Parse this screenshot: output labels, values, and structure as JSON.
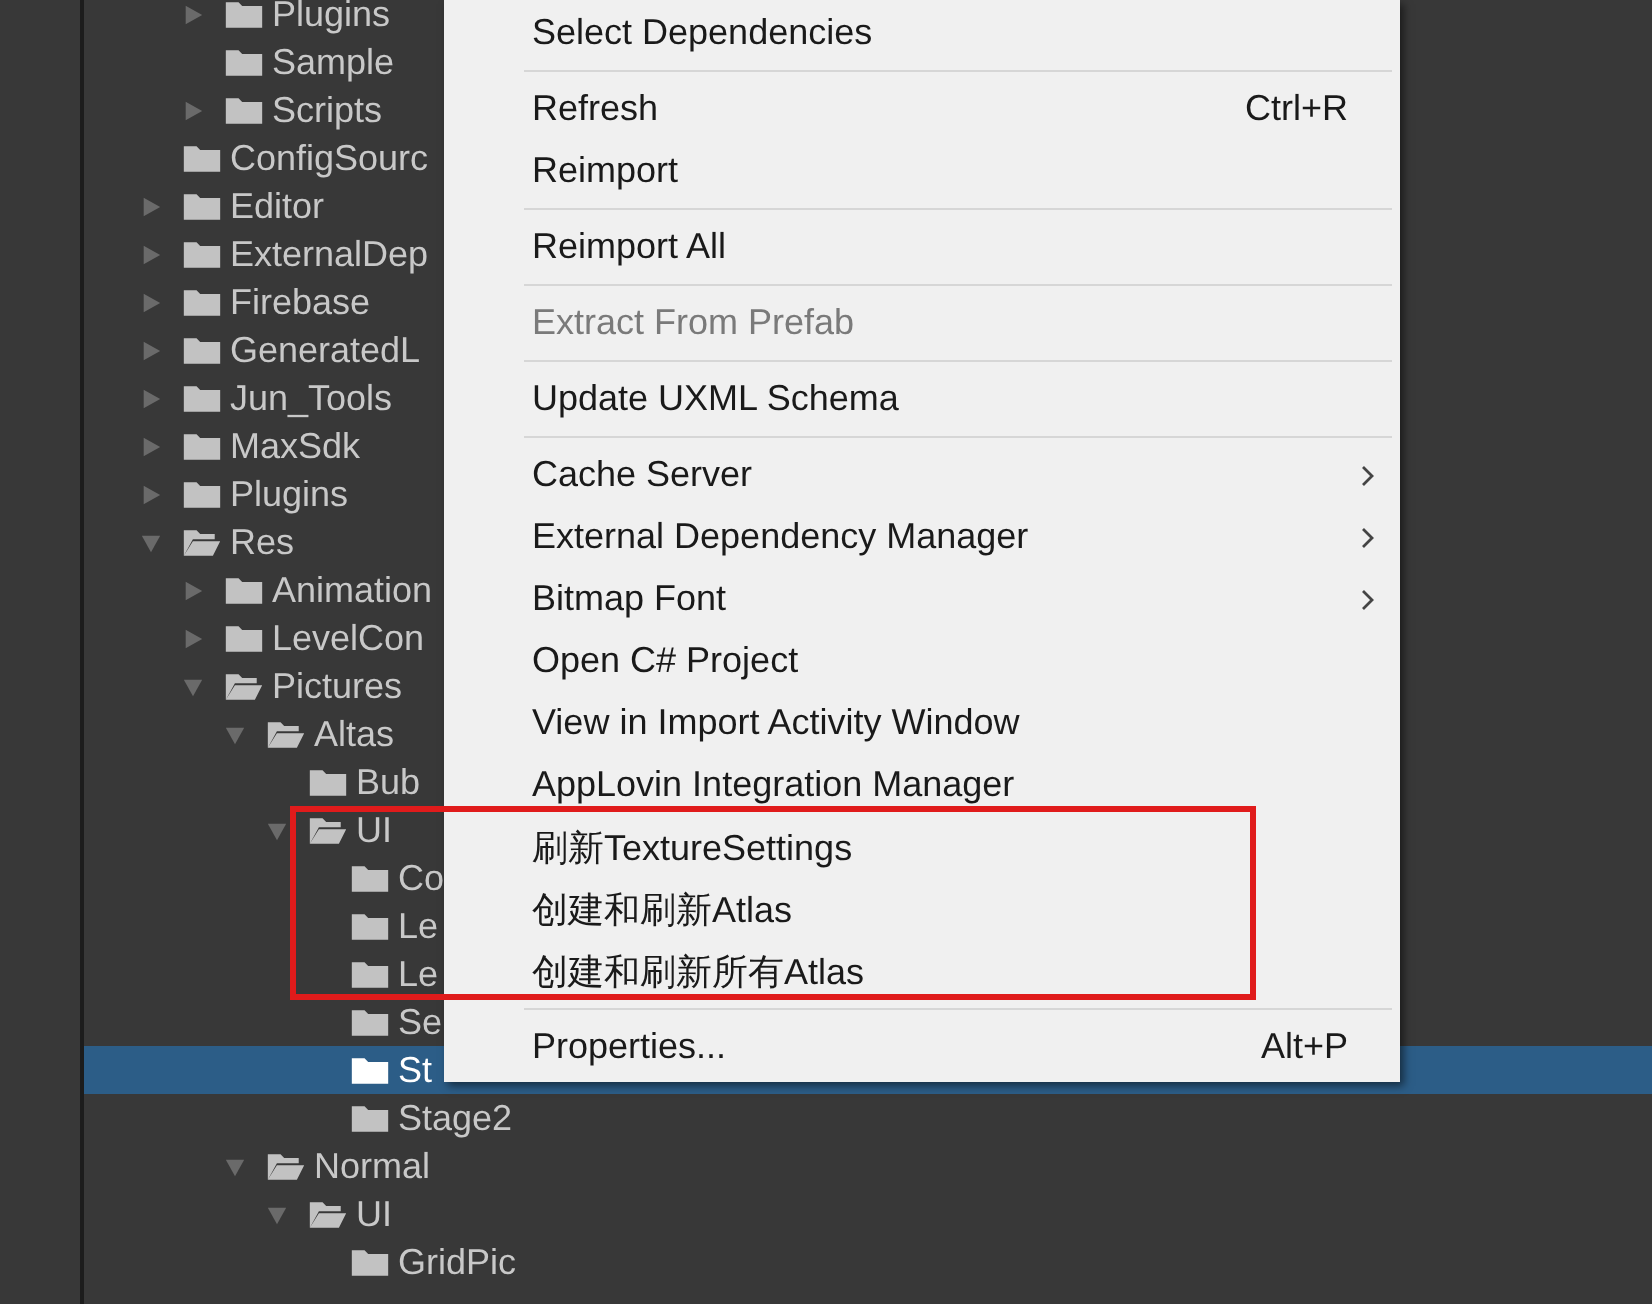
{
  "project_tree": [
    {
      "children": [
        {
          "label": "Plugins",
          "expanded": false,
          "selected": false
        },
        {
          "label": "Sample",
          "selected": false
        },
        {
          "label": "Scripts",
          "expanded": false,
          "selected": false
        }
      ]
    },
    {
      "label": "ConfigSourc",
      "selected": false
    },
    {
      "label": "Editor",
      "expanded": false,
      "selected": false
    },
    {
      "label": "ExternalDep",
      "expanded": false,
      "selected": false
    },
    {
      "label": "Firebase",
      "expanded": false,
      "selected": false
    },
    {
      "label": "GeneratedL",
      "expanded": false,
      "selected": false
    },
    {
      "label": "Jun_Tools",
      "expanded": false,
      "selected": false
    },
    {
      "label": "MaxSdk",
      "expanded": false,
      "selected": false
    },
    {
      "label": "Plugins",
      "expanded": false,
      "selected": false
    },
    {
      "label": "Res",
      "expanded": true,
      "selected": false,
      "children": [
        {
          "label": "Animation",
          "expanded": false,
          "selected": false
        },
        {
          "label": "LevelCon",
          "expanded": false,
          "selected": false
        },
        {
          "label": "Pictures",
          "expanded": true,
          "selected": false,
          "children": [
            {
              "label": "Altas",
              "expanded": true,
              "selected": false,
              "children": [
                {
                  "label": "Bub",
                  "selected": false
                },
                {
                  "label": "UI",
                  "expanded": true,
                  "selected": false,
                  "children": [
                    {
                      "label": "Co",
                      "selected": false
                    },
                    {
                      "label": "Le",
                      "selected": false
                    },
                    {
                      "label": "Le",
                      "selected": false
                    },
                    {
                      "label": "Se",
                      "selected": false
                    },
                    {
                      "label": "St",
                      "selected": true
                    },
                    {
                      "label": "Stage2",
                      "selected": false
                    }
                  ]
                }
              ]
            },
            {
              "label": "Normal",
              "expanded": true,
              "selected": false,
              "children": [
                {
                  "label": "UI",
                  "expanded": true,
                  "selected": false,
                  "children": [
                    {
                      "label": "GridPic",
                      "selected": false
                    }
                  ]
                }
              ]
            }
          ]
        }
      ]
    }
  ],
  "context_menu": [
    {
      "kind": "item",
      "label": "Select Dependencies"
    },
    {
      "kind": "separator"
    },
    {
      "kind": "item",
      "label": "Refresh",
      "shortcut": "Ctrl+R"
    },
    {
      "kind": "item",
      "label": "Reimport"
    },
    {
      "kind": "separator"
    },
    {
      "kind": "item",
      "label": "Reimport All"
    },
    {
      "kind": "separator"
    },
    {
      "kind": "item",
      "label": "Extract From Prefab",
      "disabled": true
    },
    {
      "kind": "separator"
    },
    {
      "kind": "item",
      "label": "Update UXML Schema"
    },
    {
      "kind": "separator"
    },
    {
      "kind": "item",
      "label": "Cache Server",
      "submenu": true
    },
    {
      "kind": "item",
      "label": "External Dependency Manager",
      "submenu": true
    },
    {
      "kind": "item",
      "label": "Bitmap Font",
      "submenu": true
    },
    {
      "kind": "item",
      "label": "Open C# Project"
    },
    {
      "kind": "item",
      "label": "View in Import Activity Window"
    },
    {
      "kind": "item",
      "label": "AppLovin Integration Manager"
    },
    {
      "kind": "item",
      "label": "刷新TextureSettings"
    },
    {
      "kind": "item",
      "label": "创建和刷新Atlas"
    },
    {
      "kind": "item",
      "label": "创建和刷新所有Atlas"
    },
    {
      "kind": "separator"
    },
    {
      "kind": "item",
      "label": "Properties...",
      "shortcut": "Alt+P"
    }
  ]
}
